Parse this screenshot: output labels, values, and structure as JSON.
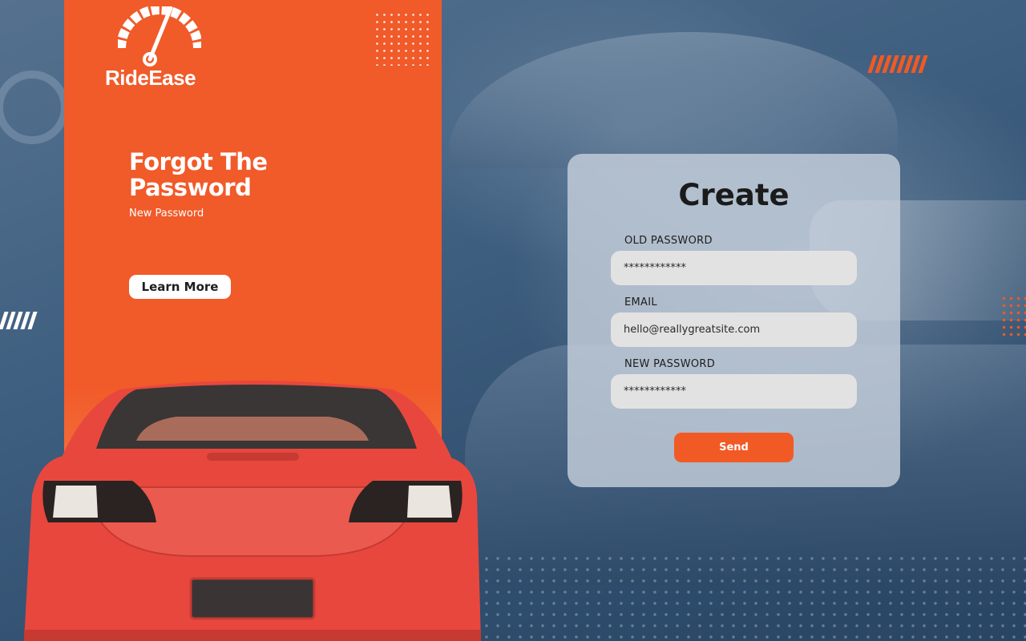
{
  "brand": {
    "name": "RideEase",
    "logo_icon": "speedometer-icon"
  },
  "hero": {
    "title": "Forgot The Password",
    "subtitle": "New Password",
    "learn_more_label": "Learn More"
  },
  "form": {
    "title": "Create",
    "old_password_label": "OLD PASSWORD",
    "old_password_value": "************",
    "email_label": "EMAIL",
    "email_value": "hello@reallygreatsite.com",
    "new_password_label": "NEW PASSWORD",
    "new_password_value": "************",
    "send_label": "Send"
  },
  "colors": {
    "accent": "#f15a29",
    "background": "#3f5f80",
    "card": "#c4ceda",
    "input": "#e2e2e2"
  }
}
